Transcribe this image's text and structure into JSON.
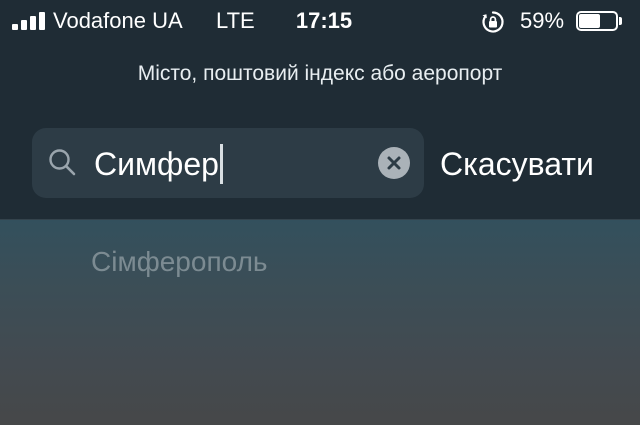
{
  "status_bar": {
    "signal_bars": 4,
    "carrier": "Vodafone UA",
    "network": "LTE",
    "time": "17:15",
    "rotation_lock_icon": "rotation-lock-icon",
    "battery_percent": "59%",
    "battery_level": 0.59
  },
  "search": {
    "prompt": "Місто, поштовий індекс або аеропорт",
    "value": "Симфер",
    "search_icon": "search-icon",
    "clear_icon": "clear-icon",
    "cancel_label": "Скасувати"
  },
  "results": [
    {
      "label": "Сімферополь"
    }
  ],
  "colors": {
    "header_background": "#1f2c35",
    "search_field_background": "#2d3c46",
    "suggestion_text": "#7c8b92",
    "clear_button": "#aab2b8"
  }
}
